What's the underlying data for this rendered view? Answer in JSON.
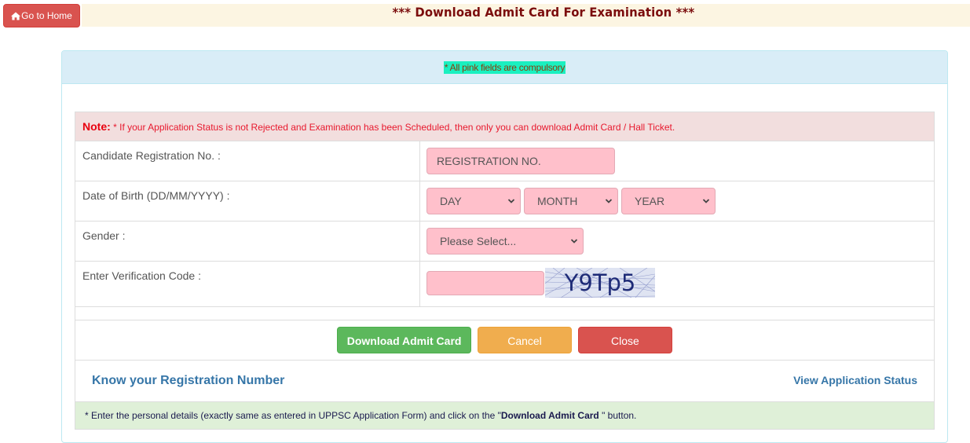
{
  "header": {
    "home_button": "Go to Home",
    "home_icon": "home-icon",
    "title": "*** Download Admit Card For Examination ***"
  },
  "panel": {
    "compulsory_notice": "* All pink fields are compulsory"
  },
  "note": {
    "label": "Note:",
    "text": " * If your Application Status is not Rejected and Examination has been Scheduled, then only you can download Admit Card / Hall Ticket."
  },
  "form": {
    "registration": {
      "label": "Candidate Registration No. :",
      "placeholder": "REGISTRATION NO.",
      "value": ""
    },
    "dob": {
      "label": "Date of Birth (DD/MM/YYYY) :",
      "day_selected": "DAY",
      "month_selected": "MONTH",
      "year_selected": "YEAR"
    },
    "gender": {
      "label": "Gender :",
      "selected": "Please Select..."
    },
    "verification": {
      "label": "Enter Verification Code :",
      "value": "",
      "captcha_text": "Y9Tp5"
    }
  },
  "buttons": {
    "download": "Download Admit Card",
    "cancel": "Cancel",
    "close": "Close"
  },
  "links": {
    "know_registration": "Know your Registration Number",
    "view_status": "View Application Status"
  },
  "instruction": {
    "prefix": "* Enter the personal details (exactly same as entered in UPPSC Application Form) and click on the \"",
    "bold": "Download Admit Card",
    "suffix": " \" button."
  },
  "colors": {
    "required_field": "#ffc0cb",
    "title": "#7b0d0d",
    "success": "#5cb85c",
    "warning": "#f0ad4e",
    "danger": "#d9534f",
    "link": "#3676a8"
  }
}
